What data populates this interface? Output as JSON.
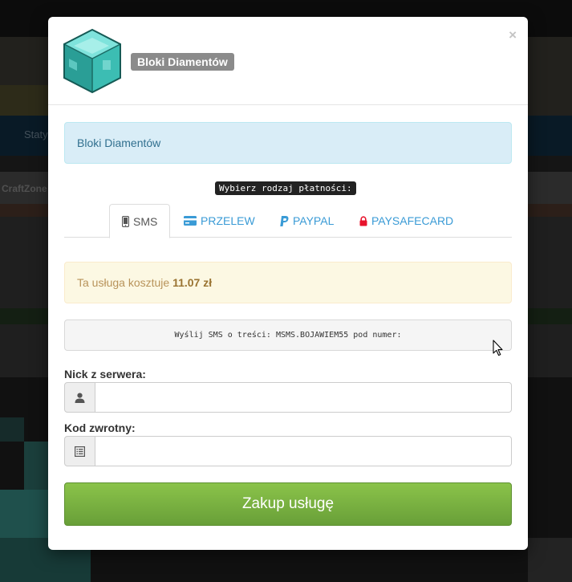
{
  "background": {
    "nav_label": "Staty",
    "strip_label": "CraftZone"
  },
  "modal": {
    "product_badge": "Bloki Diamentów",
    "close_symbol": "×",
    "info_alert": "Bloki Diamentów",
    "choose_payment_label": "Wybierz rodzaj płatności:",
    "tabs": [
      {
        "label": "SMS",
        "icon": "phone-icon",
        "active": true
      },
      {
        "label": "PRZELEW",
        "icon": "credit-card-icon",
        "active": false
      },
      {
        "label": "PAYPAL",
        "icon": "paypal-icon",
        "active": false
      },
      {
        "label": "PAYSAFECARD",
        "icon": "lock-icon",
        "active": false
      }
    ],
    "price": {
      "prefix": "Ta usługa kosztuje",
      "amount": "11.07 zł"
    },
    "sms_instruction": "Wyślij SMS o treści: MSMS.BOJAWIEM55 pod numer:",
    "nick": {
      "label": "Nick z serwera:",
      "value": "",
      "icon": "user-icon"
    },
    "code": {
      "label": "Kod zwrotny:",
      "value": "",
      "icon": "list-icon"
    },
    "buy_button": "Zakup usługę"
  },
  "colors": {
    "info_bg": "#d9edf7",
    "warning_bg": "#fcf8e3",
    "tab_link": "#3a9bd6",
    "buy_green": "#7cb342",
    "paysafe_red": "#e8132c"
  }
}
